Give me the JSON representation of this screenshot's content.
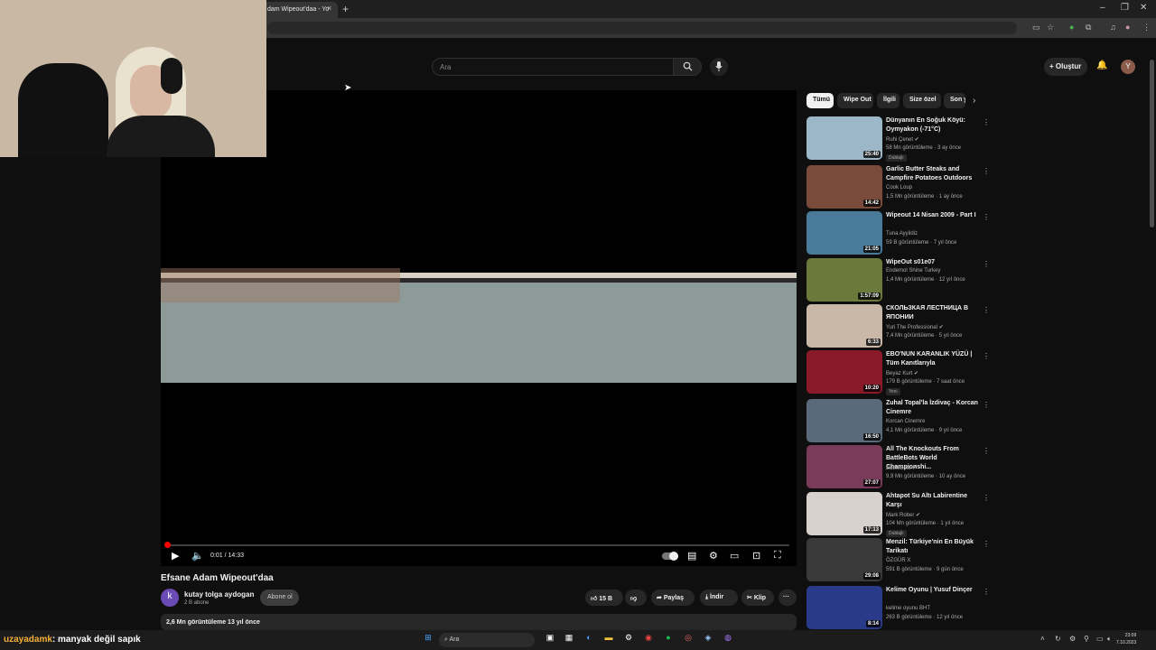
{
  "browser": {
    "tab_title": "dam Wipeout'daa - Yo",
    "tab_close": "×",
    "new_tab": "+",
    "window_controls": [
      "–",
      "❐",
      "✕"
    ]
  },
  "masthead": {
    "search_placeholder": "Ara",
    "search_icon": "search-icon",
    "mic_icon": "mic-icon",
    "create_label": "+ Oluştur",
    "avatar_letter": "Y"
  },
  "player": {
    "timecode": "0:01 / 14:33",
    "progress_fraction": 0.001
  },
  "video": {
    "title": "Efsane Adam Wipeout'daa",
    "channel_initial": "k",
    "channel_name": "kutay tolga aydogan",
    "channel_subs": "2 B abone",
    "subscribe_label": "Abone ol",
    "like_count": "15 B",
    "share_label": "Paylaş",
    "download_label": "İndir",
    "clip_label": "Klip",
    "more_label": "···",
    "desc_meta": "2,6 Mn görüntüleme  13 yıl önce"
  },
  "chips": [
    "Tümü",
    "Wipe Out",
    "İlgili",
    "Size özel",
    "Son y"
  ],
  "recommendations": [
    {
      "title": "Dünyanın En Soğuk Köyü: Oymyakon (-71°C)",
      "channel": "Ruhi Çenet ✔",
      "meta": "58 Mn görüntüleme · 3 ay önce",
      "badge": "Dublajlı",
      "duration": "25:40",
      "color": "#9cb7c8"
    },
    {
      "title": "Garlic Butter Steaks and Campfire Potatoes Outdoors",
      "channel": "Cook Loup",
      "meta": "1,5 Mn görüntüleme · 1 ay önce",
      "badge": "",
      "duration": "14:42",
      "color": "#7a4a3a"
    },
    {
      "title": "Wipeout 14 Nisan 2009 - Part I",
      "channel": "Tuna Ayyildiz",
      "meta": "59 B görüntüleme · 7 yıl önce",
      "badge": "",
      "duration": "21:05",
      "color": "#4a7a9a"
    },
    {
      "title": "WipeOut s01e07",
      "channel": "Endemol Shine Turkey",
      "meta": "1,4 Mn görüntüleme · 12 yıl önce",
      "badge": "",
      "duration": "1:57:09",
      "color": "#6b7a3a"
    },
    {
      "title": "СКОЛЬЗКАЯ ЛЕСТНИЦА В ЯПОНИИ",
      "channel": "Yuri The Professional ✔",
      "meta": "7,4 Mn görüntüleme · 5 yıl önce",
      "badge": "",
      "duration": "6:33",
      "color": "#c9b8a8"
    },
    {
      "title": "EBO'NUN KARANLIK YÜZÜ | Tüm Kanıtlarıyla",
      "channel": "Beyaz Kurt ✔",
      "meta": "179 B görüntüleme · 7 saat önce",
      "badge": "Yeni",
      "duration": "10:20",
      "color": "#8a1a2a"
    },
    {
      "title": "Zuhal Topal'la İzdivaç - Korcan Cinemre",
      "channel": "Korcan Cinemre",
      "meta": "4,1 Mn görüntüleme · 9 yıl önce",
      "badge": "",
      "duration": "16:50",
      "color": "#5a6a7a"
    },
    {
      "title": "All The Knockouts From BattleBots World Championshi...",
      "channel": "BattleBots ✔",
      "meta": "9,9 Mn görüntüleme · 10 ay önce",
      "badge": "",
      "duration": "27:07",
      "color": "#7a3a5a"
    },
    {
      "title": "Ahtapot Su Altı Labirentine Karşı",
      "channel": "Mark Rober ✔",
      "meta": "104 Mn görüntüleme · 1 yıl önce",
      "badge": "Dublajlı",
      "duration": "17:13",
      "color": "#d8d0cc"
    },
    {
      "title": "Menzil: Türkiye'nin En Büyük Tarikatı",
      "channel": "ÖZGÜR X",
      "meta": "591 B görüntüleme · 9 gün önce",
      "badge": "",
      "duration": "29:08",
      "color": "#3a3a3a"
    },
    {
      "title": "Kelime Oyunu | Yusuf Dinçer",
      "channel": "kelime oyunu BHT",
      "meta": "263 B görüntüleme · 12 yıl önce",
      "badge": "",
      "duration": "8:14",
      "color": "#2a3a8a"
    }
  ],
  "chat": {
    "user": "uzayadamk",
    "message": ": manyak değil sapık"
  },
  "taskbar": {
    "search_label": "Ara",
    "time": "23:09",
    "date": "7.10.2023"
  }
}
